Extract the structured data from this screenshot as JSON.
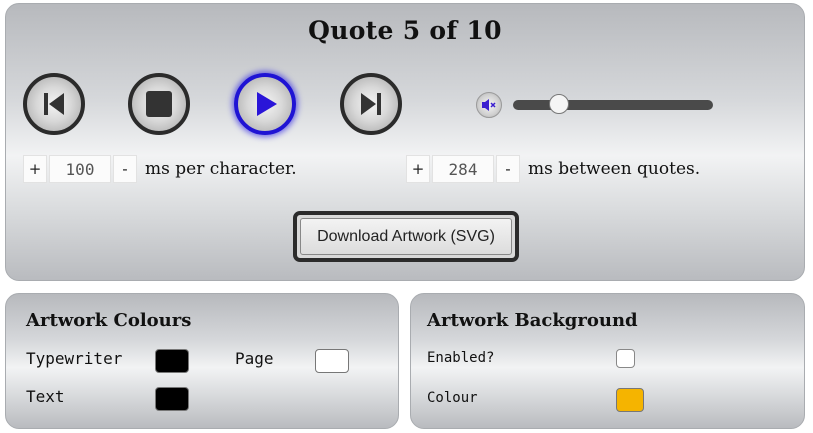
{
  "header": {
    "title": "Quote 5 of 10"
  },
  "controls": {
    "prev": "skip-previous-icon",
    "stop": "stop-icon",
    "play": "play-icon",
    "next": "skip-next-icon",
    "active_color": "#1f13d4"
  },
  "volume": {
    "icon": "mute-icon",
    "level": 0.23
  },
  "speed": {
    "value": "100",
    "unit_label": "ms per character.",
    "plus": "+",
    "minus": "-"
  },
  "pause": {
    "value": "284",
    "unit_label": "ms between quotes.",
    "plus": "+",
    "minus": "-"
  },
  "download_label": "Download Artwork (SVG)",
  "artwork_colours": {
    "title": "Artwork Colours",
    "typewriter_label": "Typewriter",
    "typewriter_color": "#000000",
    "page_label": "Page",
    "page_color": "#ffffff",
    "text_label": "Text",
    "text_color": "#000000"
  },
  "artwork_background": {
    "title": "Artwork Background",
    "enabled_label": "Enabled?",
    "enabled": false,
    "colour_label": "Colour",
    "colour": "#f5b400"
  }
}
